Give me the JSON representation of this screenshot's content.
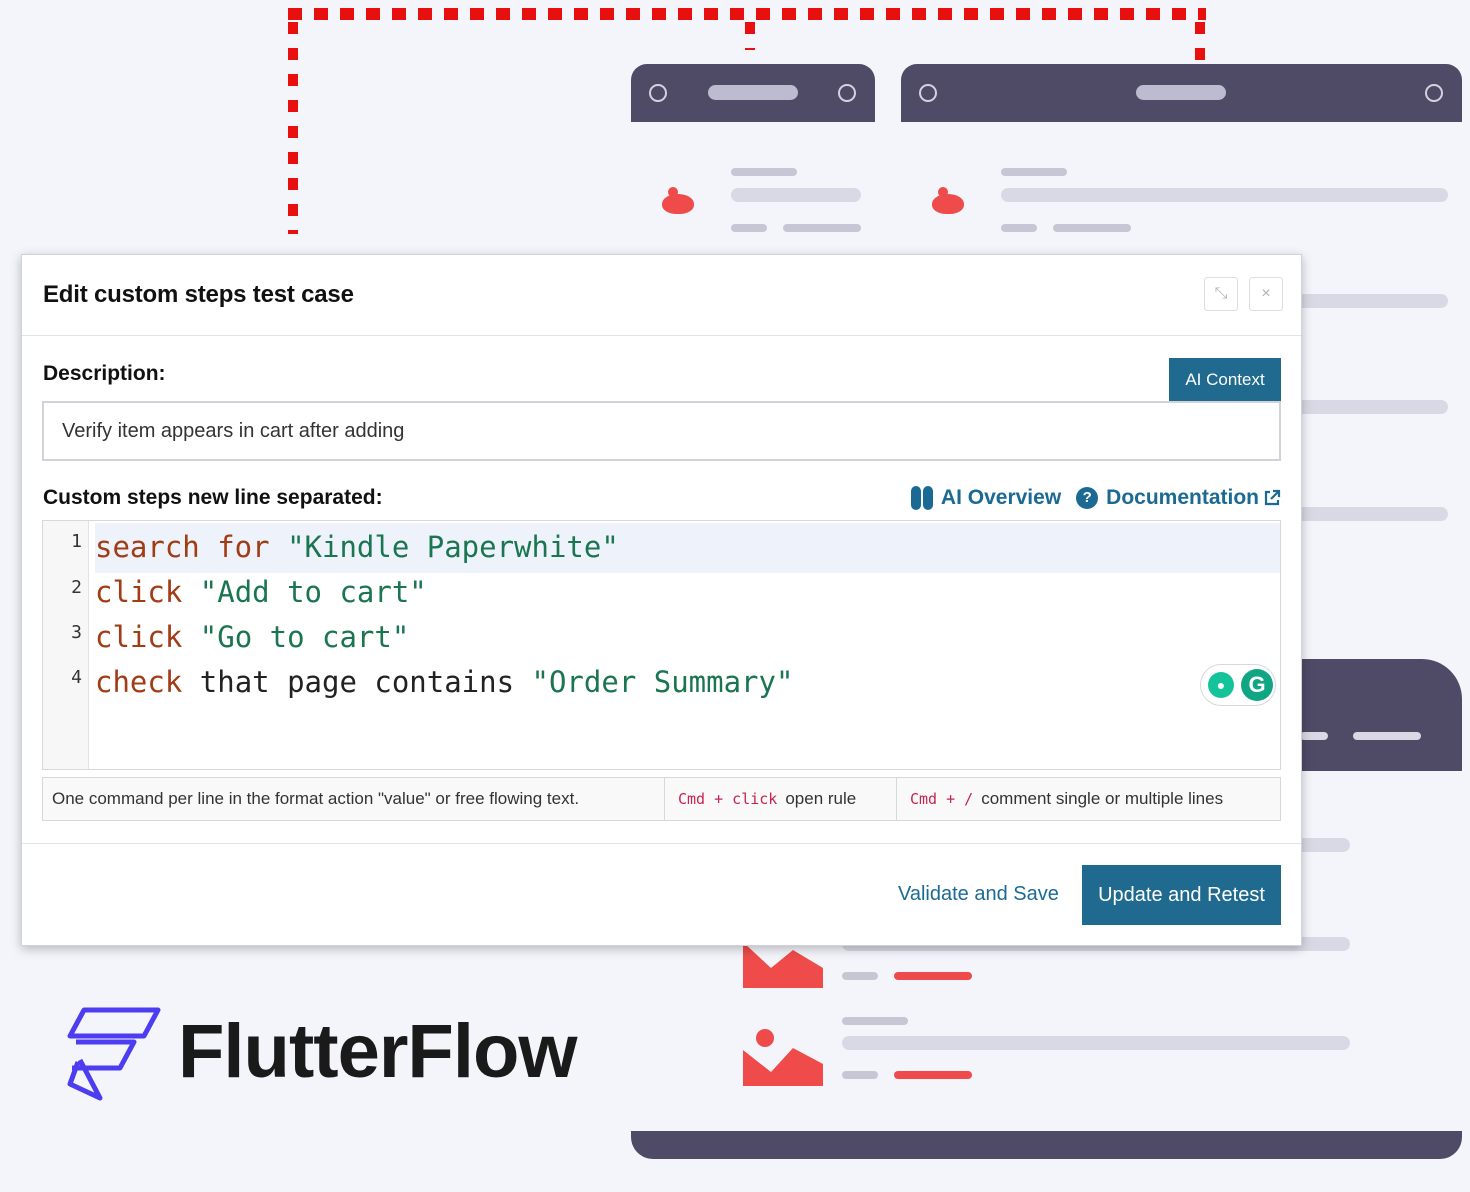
{
  "modal": {
    "title": "Edit custom steps test case",
    "description_label": "Description:",
    "ai_context_label": "AI Context",
    "description_value": "Verify item appears in cart after adding",
    "steps_label": "Custom steps new line separated:",
    "ai_overview_label": "AI Overview",
    "documentation_label": "Documentation",
    "line_numbers": [
      "1",
      "2",
      "3",
      "4"
    ],
    "code_lines": [
      {
        "keyword": "search for",
        "text": " ",
        "string": "\"Kindle Paperwhite\""
      },
      {
        "keyword": "click",
        "text": " ",
        "string": "\"Add to cart\""
      },
      {
        "keyword": "click",
        "text": " ",
        "string": "\"Go to cart\""
      },
      {
        "keyword": "check",
        "text": " that page contains ",
        "string": "\"Order Summary\""
      }
    ],
    "hints": {
      "format_hint": "One command per line in the format action \"value\" or free flowing text.",
      "rule_shortcut": "Cmd + click",
      "rule_label": "open rule",
      "comment_shortcut": "Cmd + /",
      "comment_label": "comment single or multiple lines"
    },
    "validate_label": "Validate and Save",
    "update_label": "Update and Retest",
    "close_symbol": "×",
    "expand_symbol": "⤡"
  },
  "logo": {
    "text": "FlutterFlow"
  },
  "colors": {
    "accent": "#1f6a8e",
    "link": "#1b6a93",
    "keyword": "#a13c14",
    "string": "#1a7550",
    "window_bar": "#4f4b66",
    "highlight_red": "#ef4b4b",
    "dotted_red": "#e8100f",
    "logo_purple": "#4d3df0"
  }
}
